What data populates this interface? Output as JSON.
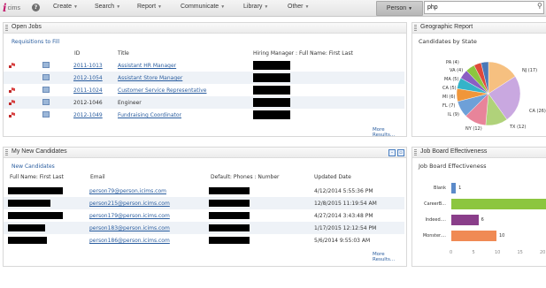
{
  "brand": {
    "logo_i": "i",
    "logo_text": "cims"
  },
  "nav": {
    "menus": [
      {
        "label": "Create"
      },
      {
        "label": "Search"
      },
      {
        "label": "Report"
      },
      {
        "label": "Communicate"
      },
      {
        "label": "Library"
      },
      {
        "label": "Other"
      }
    ],
    "search_scope": "Person",
    "search_value": "php"
  },
  "open_jobs": {
    "title": "Open Jobs",
    "link": "Requisitions to Fill",
    "columns": {
      "id": "ID",
      "title": "Title",
      "manager": "Hiring Manager : Full Name: First Last"
    },
    "rows": [
      {
        "id": "2011-1013",
        "title": "Assistant HR Manager"
      },
      {
        "id": "2012-1054",
        "title": "Assistant Store Manager"
      },
      {
        "id": "2011-1024",
        "title": "Customer Service Representative"
      },
      {
        "id": "2012-1046",
        "title": "Engineer"
      },
      {
        "id": "2012-1049",
        "title": "Fundraising Coordinator"
      }
    ],
    "more": "More Results..."
  },
  "candidates": {
    "title": "My New Candidates",
    "subtitle": "New Candidates",
    "columns": {
      "name": "Full Name: First Last",
      "email": "Email",
      "phone": "Default: Phones : Number",
      "updated": "Updated Date"
    },
    "rows": [
      {
        "email": "person79@person.icims.com",
        "updated": "4/12/2014 5:55:36 PM"
      },
      {
        "email": "person215@person.icims.com",
        "updated": "12/8/2015 11:19:54 AM"
      },
      {
        "email": "person179@person.icims.com",
        "updated": "4/27/2014 3:43:48 PM"
      },
      {
        "email": "person183@person.icims.com",
        "updated": "1/17/2015 12:12:54 PM"
      },
      {
        "email": "person186@person.icims.com",
        "updated": "5/6/2014 9:55:03 AM"
      }
    ],
    "more": "More Results..."
  },
  "geo": {
    "title": "Geographic Report",
    "subtitle": "Candidates by State",
    "labels": [
      "PA (4)",
      "VA (4)",
      "MA (5)",
      "CA (5)",
      "MI (6)",
      "FL (7)",
      "IL (9)",
      "NY (12)",
      "TX (12)",
      "CA (26)",
      "NJ (17)"
    ],
    "colors": [
      "#4a78b8",
      "#e04a3a",
      "#8cc63f",
      "#8a5ec4",
      "#35b3c9",
      "#f0963a",
      "#6ea0d8",
      "#e8849a",
      "#b0d27a",
      "#c9a8e0",
      "#f6c080"
    ]
  },
  "job_board": {
    "title": "Job Board Effectiveness",
    "subtitle": "Job Board Effectiveness",
    "bars": [
      {
        "label": "Blank",
        "value": 1,
        "color": "#5b8ac9"
      },
      {
        "label": "CareerB...",
        "value": 23,
        "color": "#8cc63f"
      },
      {
        "label": "Indeed....",
        "value": 6,
        "color": "#8a3e8a"
      },
      {
        "label": "Monster....",
        "value": 10,
        "color": "#f08a54"
      }
    ],
    "ticks": [
      "0",
      "5",
      "10",
      "15",
      "20"
    ]
  }
}
